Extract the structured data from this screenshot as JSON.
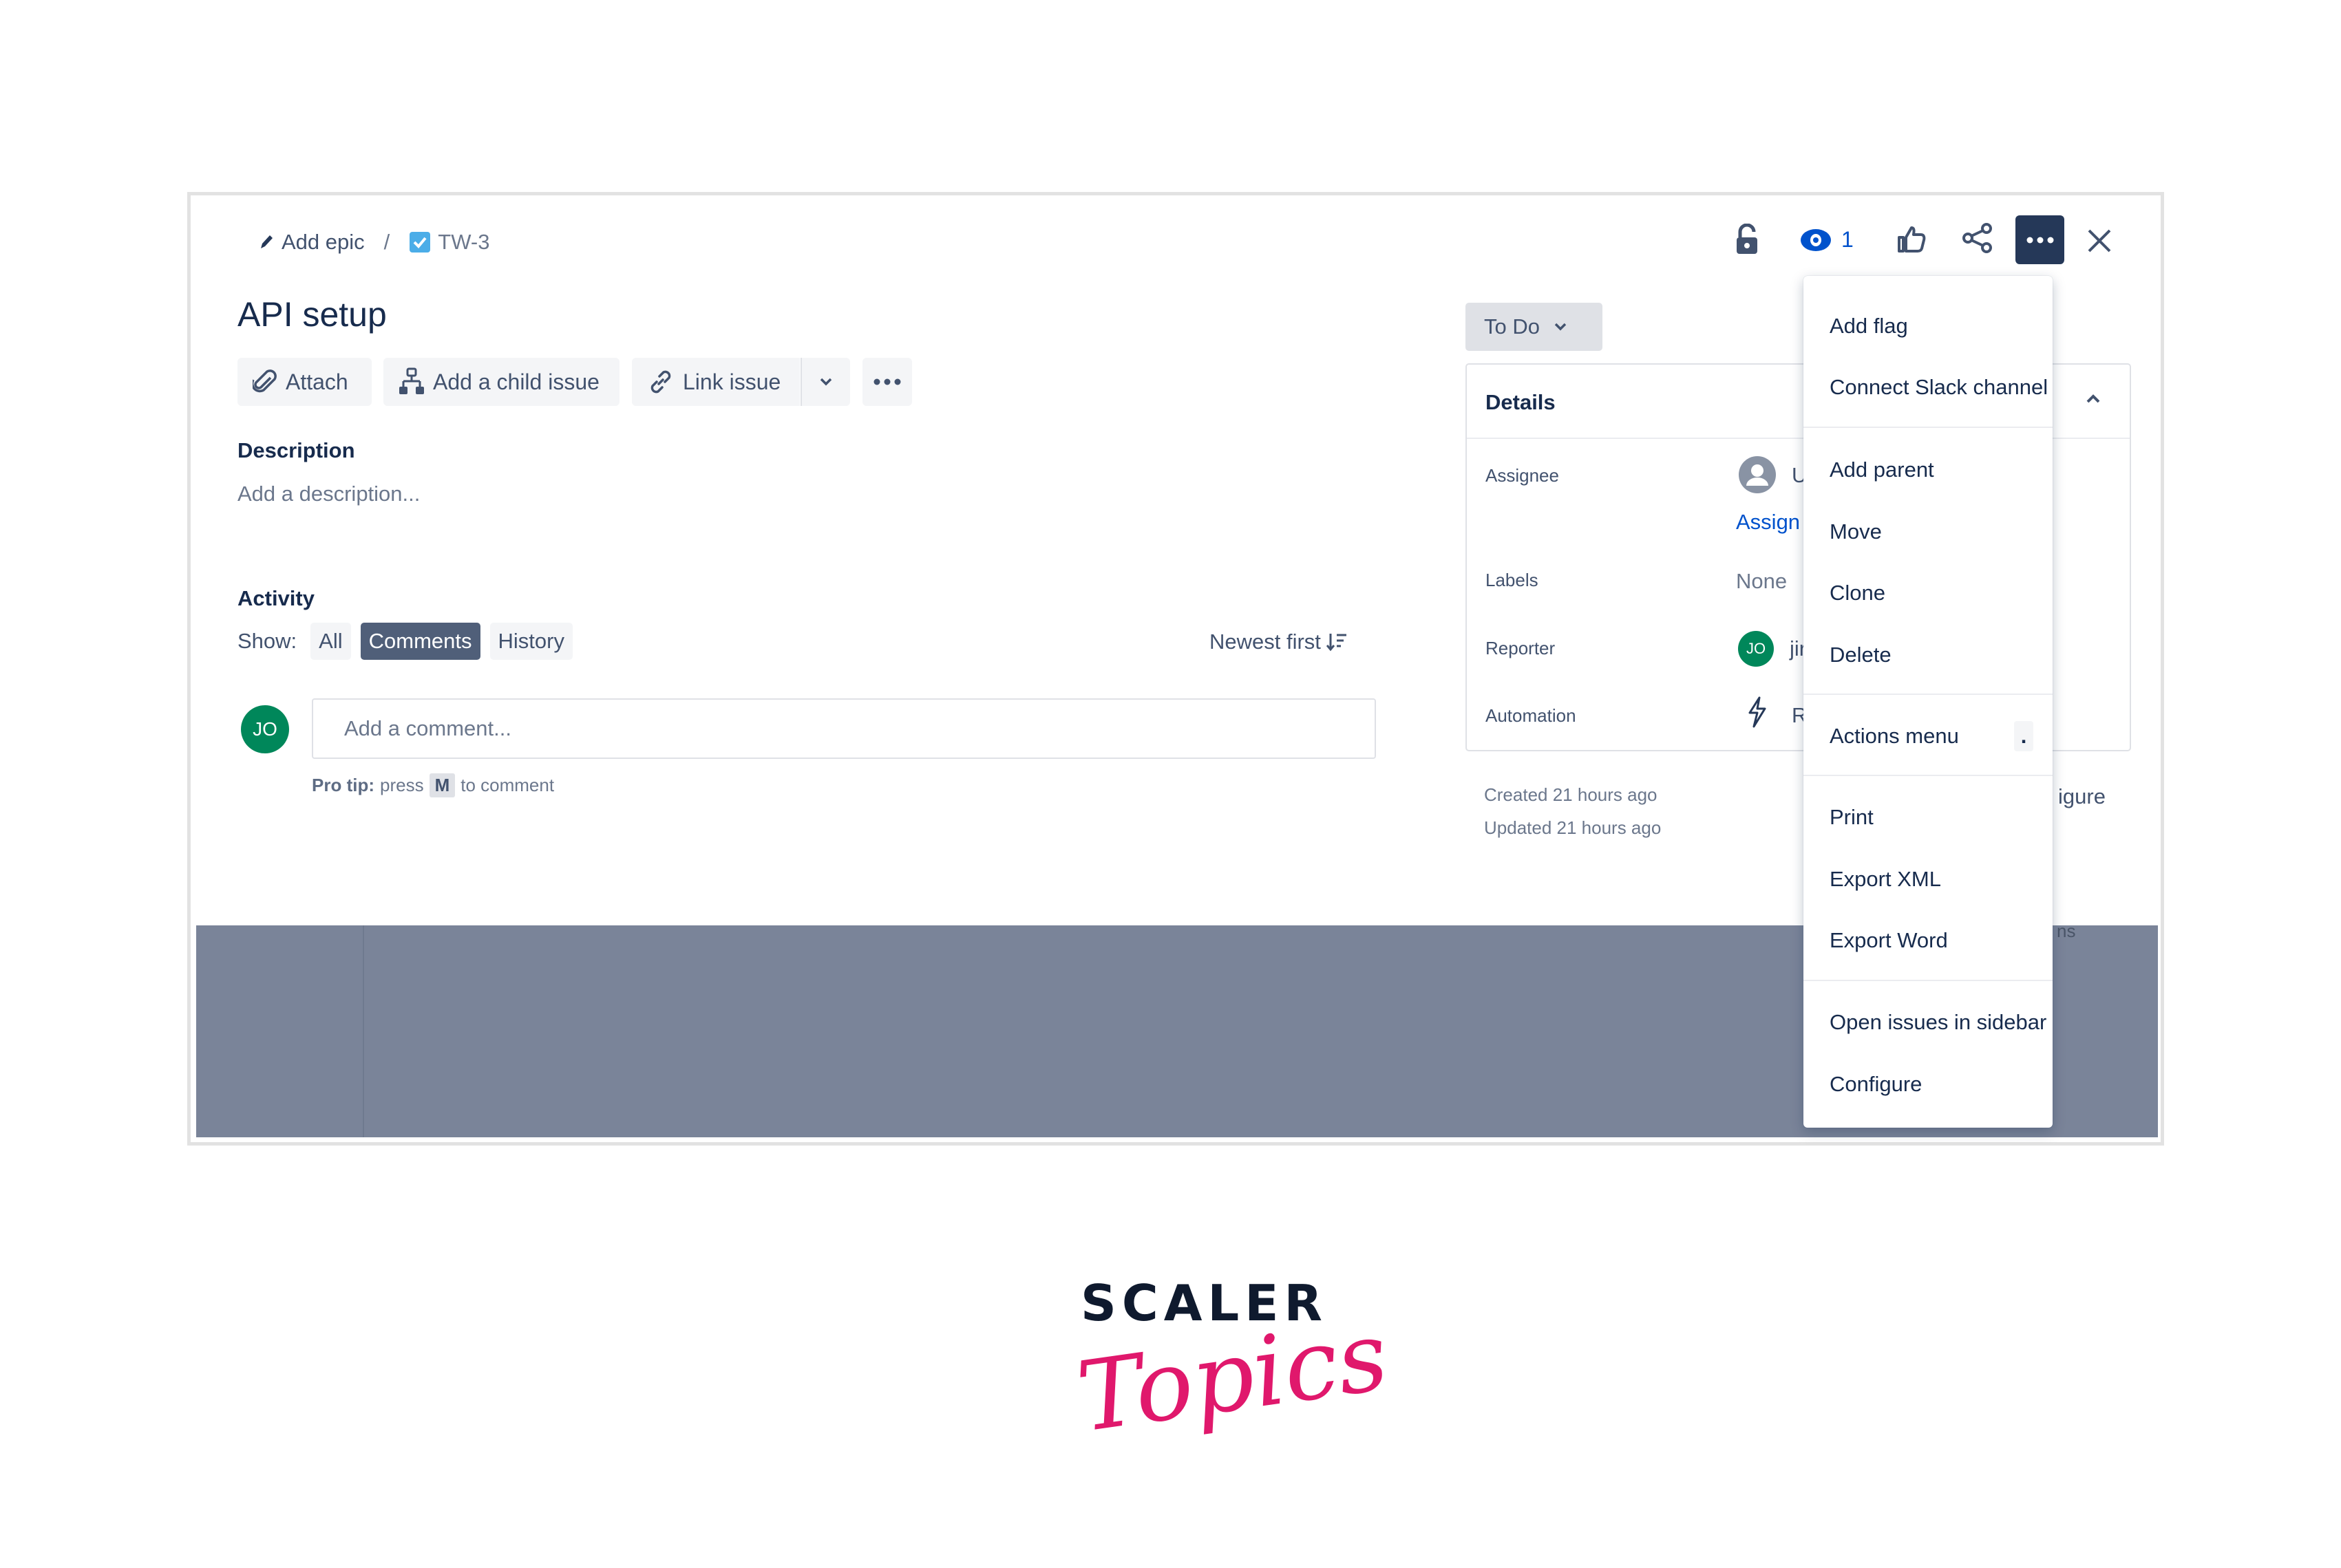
{
  "breadcrumb": {
    "epic_label": "Add epic",
    "separator": "/",
    "issue_key": "TW-3"
  },
  "header": {
    "watch_count": "1"
  },
  "issue": {
    "title": "API setup"
  },
  "toolbar": {
    "attach": "Attach",
    "add_child": "Add a child issue",
    "link_issue": "Link issue"
  },
  "description": {
    "heading": "Description",
    "placeholder": "Add a description..."
  },
  "activity": {
    "heading": "Activity",
    "show_label": "Show:",
    "tabs": [
      {
        "label": "All"
      },
      {
        "label": "Comments",
        "active": true
      },
      {
        "label": "History"
      }
    ],
    "sort_label": "Newest first",
    "avatar_initials": "JO",
    "comment_placeholder": "Add a comment...",
    "pro_tip_bold": "Pro tip:",
    "pro_tip_pre": "press",
    "pro_tip_key": "M",
    "pro_tip_post": "to comment"
  },
  "status": {
    "label": "To Do"
  },
  "details": {
    "heading": "Details",
    "rows": [
      {
        "label": "Assignee",
        "value": "Ur",
        "link": "Assign t"
      },
      {
        "label": "Labels",
        "value": "None"
      },
      {
        "label": "Reporter",
        "value": "jir",
        "avatar": "JO"
      },
      {
        "label": "Automation",
        "value": "Ru"
      }
    ],
    "created": "Created 21 hours ago",
    "updated": "Updated 21 hours ago",
    "configure_partial": "igure",
    "partial_ns": "ns"
  },
  "menu": {
    "items": [
      "Add flag",
      "Connect Slack channel",
      "Add parent",
      "Move",
      "Clone",
      "Delete",
      "Actions menu",
      "Print",
      "Export XML",
      "Export Word",
      "Open issues in sidebar",
      "Configure"
    ],
    "actions_shortcut": "."
  },
  "branding": {
    "line1": "SCALER",
    "line2": "Topics",
    "pink": "#e0186c",
    "navy": "#0f1a2e"
  }
}
